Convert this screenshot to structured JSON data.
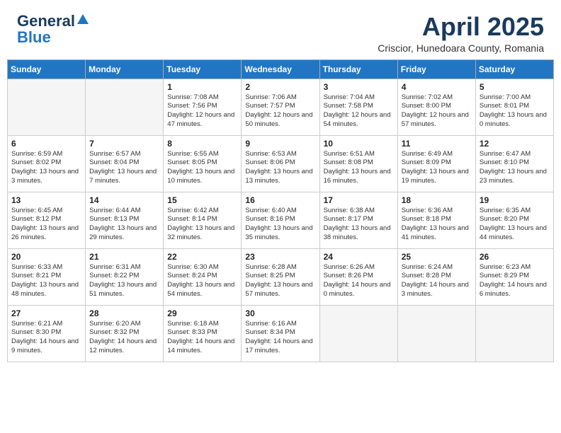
{
  "logo": {
    "general": "General",
    "blue": "Blue"
  },
  "header": {
    "title": "April 2025",
    "subtitle": "Criscior, Hunedoara County, Romania"
  },
  "days": [
    "Sunday",
    "Monday",
    "Tuesday",
    "Wednesday",
    "Thursday",
    "Friday",
    "Saturday"
  ],
  "weeks": [
    [
      {
        "day": "",
        "content": ""
      },
      {
        "day": "",
        "content": ""
      },
      {
        "day": "1",
        "content": "Sunrise: 7:08 AM\nSunset: 7:56 PM\nDaylight: 12 hours and 47 minutes."
      },
      {
        "day": "2",
        "content": "Sunrise: 7:06 AM\nSunset: 7:57 PM\nDaylight: 12 hours and 50 minutes."
      },
      {
        "day": "3",
        "content": "Sunrise: 7:04 AM\nSunset: 7:58 PM\nDaylight: 12 hours and 54 minutes."
      },
      {
        "day": "4",
        "content": "Sunrise: 7:02 AM\nSunset: 8:00 PM\nDaylight: 12 hours and 57 minutes."
      },
      {
        "day": "5",
        "content": "Sunrise: 7:00 AM\nSunset: 8:01 PM\nDaylight: 13 hours and 0 minutes."
      }
    ],
    [
      {
        "day": "6",
        "content": "Sunrise: 6:59 AM\nSunset: 8:02 PM\nDaylight: 13 hours and 3 minutes."
      },
      {
        "day": "7",
        "content": "Sunrise: 6:57 AM\nSunset: 8:04 PM\nDaylight: 13 hours and 7 minutes."
      },
      {
        "day": "8",
        "content": "Sunrise: 6:55 AM\nSunset: 8:05 PM\nDaylight: 13 hours and 10 minutes."
      },
      {
        "day": "9",
        "content": "Sunrise: 6:53 AM\nSunset: 8:06 PM\nDaylight: 13 hours and 13 minutes."
      },
      {
        "day": "10",
        "content": "Sunrise: 6:51 AM\nSunset: 8:08 PM\nDaylight: 13 hours and 16 minutes."
      },
      {
        "day": "11",
        "content": "Sunrise: 6:49 AM\nSunset: 8:09 PM\nDaylight: 13 hours and 19 minutes."
      },
      {
        "day": "12",
        "content": "Sunrise: 6:47 AM\nSunset: 8:10 PM\nDaylight: 13 hours and 23 minutes."
      }
    ],
    [
      {
        "day": "13",
        "content": "Sunrise: 6:45 AM\nSunset: 8:12 PM\nDaylight: 13 hours and 26 minutes."
      },
      {
        "day": "14",
        "content": "Sunrise: 6:44 AM\nSunset: 8:13 PM\nDaylight: 13 hours and 29 minutes."
      },
      {
        "day": "15",
        "content": "Sunrise: 6:42 AM\nSunset: 8:14 PM\nDaylight: 13 hours and 32 minutes."
      },
      {
        "day": "16",
        "content": "Sunrise: 6:40 AM\nSunset: 8:16 PM\nDaylight: 13 hours and 35 minutes."
      },
      {
        "day": "17",
        "content": "Sunrise: 6:38 AM\nSunset: 8:17 PM\nDaylight: 13 hours and 38 minutes."
      },
      {
        "day": "18",
        "content": "Sunrise: 6:36 AM\nSunset: 8:18 PM\nDaylight: 13 hours and 41 minutes."
      },
      {
        "day": "19",
        "content": "Sunrise: 6:35 AM\nSunset: 8:20 PM\nDaylight: 13 hours and 44 minutes."
      }
    ],
    [
      {
        "day": "20",
        "content": "Sunrise: 6:33 AM\nSunset: 8:21 PM\nDaylight: 13 hours and 48 minutes."
      },
      {
        "day": "21",
        "content": "Sunrise: 6:31 AM\nSunset: 8:22 PM\nDaylight: 13 hours and 51 minutes."
      },
      {
        "day": "22",
        "content": "Sunrise: 6:30 AM\nSunset: 8:24 PM\nDaylight: 13 hours and 54 minutes."
      },
      {
        "day": "23",
        "content": "Sunrise: 6:28 AM\nSunset: 8:25 PM\nDaylight: 13 hours and 57 minutes."
      },
      {
        "day": "24",
        "content": "Sunrise: 6:26 AM\nSunset: 8:26 PM\nDaylight: 14 hours and 0 minutes."
      },
      {
        "day": "25",
        "content": "Sunrise: 6:24 AM\nSunset: 8:28 PM\nDaylight: 14 hours and 3 minutes."
      },
      {
        "day": "26",
        "content": "Sunrise: 6:23 AM\nSunset: 8:29 PM\nDaylight: 14 hours and 6 minutes."
      }
    ],
    [
      {
        "day": "27",
        "content": "Sunrise: 6:21 AM\nSunset: 8:30 PM\nDaylight: 14 hours and 9 minutes."
      },
      {
        "day": "28",
        "content": "Sunrise: 6:20 AM\nSunset: 8:32 PM\nDaylight: 14 hours and 12 minutes."
      },
      {
        "day": "29",
        "content": "Sunrise: 6:18 AM\nSunset: 8:33 PM\nDaylight: 14 hours and 14 minutes."
      },
      {
        "day": "30",
        "content": "Sunrise: 6:16 AM\nSunset: 8:34 PM\nDaylight: 14 hours and 17 minutes."
      },
      {
        "day": "",
        "content": ""
      },
      {
        "day": "",
        "content": ""
      },
      {
        "day": "",
        "content": ""
      }
    ]
  ]
}
